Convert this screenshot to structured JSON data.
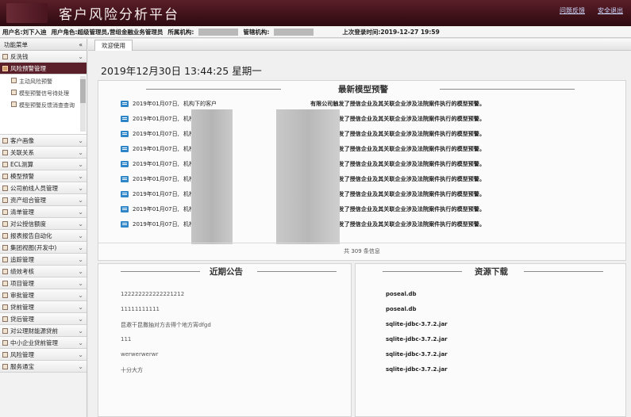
{
  "header": {
    "title": "客户风险分析平台",
    "links": [
      "问题反馈",
      "安全退出"
    ]
  },
  "infobar": {
    "user_label": "用户名:刘下入迪",
    "role_label": "用户角色:超级管理员,营组金融业务管理员",
    "org_label": "所属机构:",
    "dept_label": "管辖机构:",
    "last_login": "上次登录时间:2019-12-27 19:59"
  },
  "sidebar": {
    "header": "功能菜单",
    "collapse_icon": "«",
    "items_top": [
      {
        "label": "反洗钱",
        "active": false
      },
      {
        "label": "风险预警管理",
        "active": true
      }
    ],
    "submenu": [
      "主动风险预警",
      "模型预警信号待处理",
      "模型预警反馈消查查询"
    ],
    "items": [
      "客户画像",
      "关联关系",
      "ECL测算",
      "模型预警",
      "公司前线人员管理",
      "资产组合管理",
      "清单管理",
      "对公授信额度",
      "报表报告自动化",
      "集团视图(开发中)",
      "追踪管理",
      "绩效考核",
      "项目管理",
      "审批管理",
      "贷前管理",
      "贷后管理",
      "对公理财能源贷前",
      "中小企业贷前管理",
      "风险管理",
      "服务通宝"
    ]
  },
  "main": {
    "tab": "欢迎使用",
    "datetime": "2019年12月30日 13:44:25 星期一",
    "model_warning": {
      "title": "最新模型预警",
      "rows": [
        {
          "date": "2019年01月07日,",
          "mid": "机构下的客户",
          "end": "有限公司触发了授信企业及其关联企业涉及法院案件执行的模型预警。"
        },
        {
          "date": "2019年01月07日,",
          "mid": "机构下的客户",
          "end": "有限公司触发了授信企业及其关联企业涉及法院案件执行的模型预警。"
        },
        {
          "date": "2019年01月07日,",
          "mid": "机构下的客户",
          "end": "有限公司触发了授信企业及其关联企业涉及法院案件执行的模型预警。"
        },
        {
          "date": "2019年01月07日,",
          "mid": "机构下的客户",
          "end": "有限公司触发了授信企业及其关联企业涉及法院案件执行的模型预警。"
        },
        {
          "date": "2019年01月07日,",
          "mid": "机构下的客户",
          "end": "有限公司触发了授信企业及其关联企业涉及法院案件执行的模型预警。"
        },
        {
          "date": "2019年01月07日,",
          "mid": "机构下的客户",
          "end": "有限公司触发了授信企业及其关联企业涉及法院案件执行的模型预警。"
        },
        {
          "date": "2019年01月07日,",
          "mid": "机构下的客户",
          "end": "有限公司触发了授信企业及其关联企业涉及法院案件执行的模型预警。"
        },
        {
          "date": "2019年01月07日,",
          "mid": "机构下的客户",
          "end": "有限公司触发了授信企业及其关联企业涉及法院案件执行的模型预警。"
        },
        {
          "date": "2019年01月07日,",
          "mid": "机构下的客户",
          "end": "有限公司触发了授信企业及其关联企业涉及法院案件执行的模型预警。"
        }
      ],
      "footer": "共 309 条信息"
    },
    "notices": {
      "title": "近期公告",
      "items": [
        "122222222222221212",
        "11111111111",
        "昆邀干昆撒抽对方去得个地方宵dfgd",
        "111",
        "werwerwerwr",
        "十分大方"
      ]
    },
    "downloads": {
      "title": "资源下载",
      "items": [
        "poseal.db",
        "poseal.db",
        "sqlite-jdbc-3.7.2.jar",
        "sqlite-jdbc-3.7.2.jar",
        "sqlite-jdbc-3.7.2.jar",
        "sqlite-jdbc-3.7.2.jar"
      ]
    }
  }
}
